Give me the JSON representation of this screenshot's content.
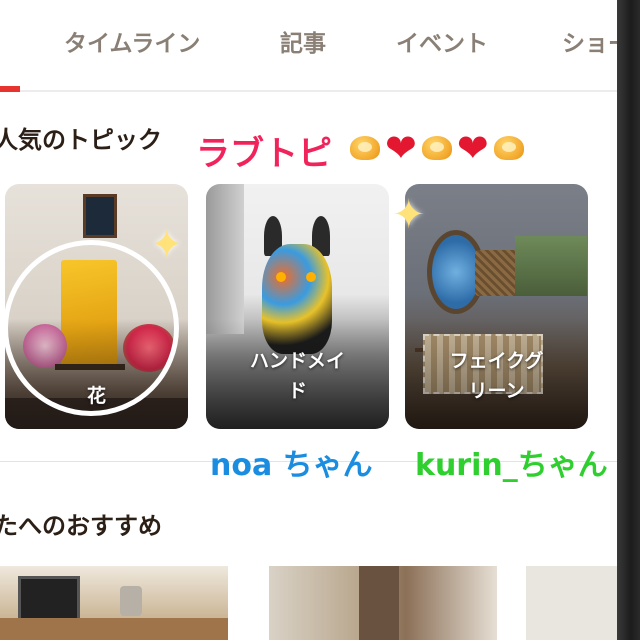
{
  "tabs": [
    {
      "label": "タイムライン"
    },
    {
      "label": "記事"
    },
    {
      "label": "イベント"
    },
    {
      "label": "ショー"
    }
  ],
  "popular": {
    "title": "人気のトピック",
    "note": "ラブトピ",
    "emoji": [
      "heart-hands",
      "heart",
      "heart-hands",
      "heart",
      "heart-hands"
    ],
    "cards": [
      {
        "label": "花"
      },
      {
        "label": "ハンドメイ\nド"
      },
      {
        "label": "フェイクグ\nリーン"
      }
    ]
  },
  "credits": {
    "noa": "noa ちゃん",
    "kurin": "kurin_ちゃん"
  },
  "recommend": {
    "title": "たへのおすすめ"
  },
  "colors": {
    "accent": "#e8342e",
    "love_note": "#f0245a",
    "noa": "#1a8de0",
    "kurin": "#2fcf2f",
    "tab_text": "#8a7f75",
    "heading": "#2b1f16"
  }
}
